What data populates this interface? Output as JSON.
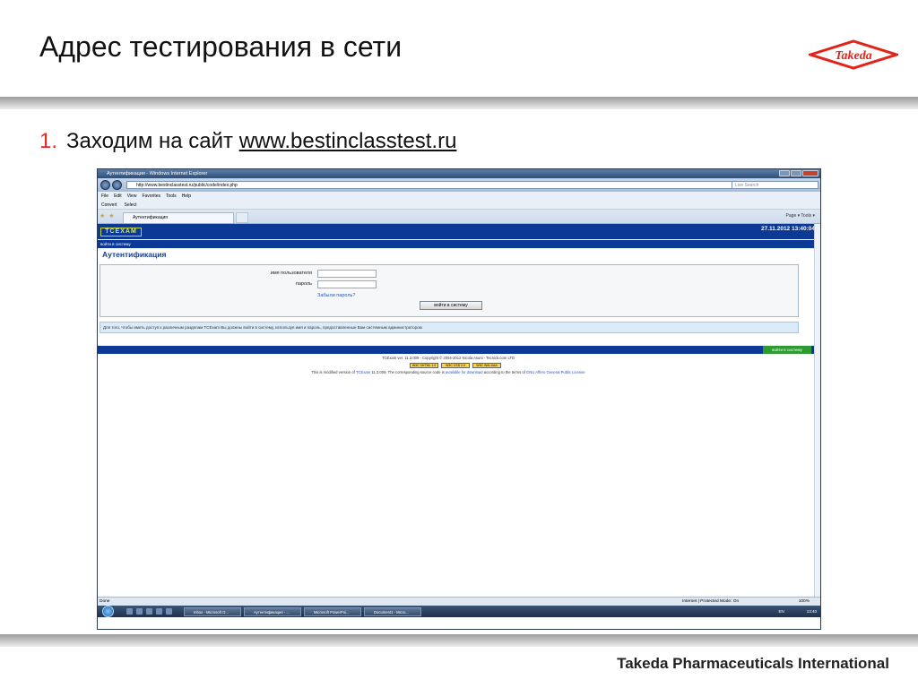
{
  "slide": {
    "title": "Адрес тестирования в сети",
    "logo_text": "Takeda",
    "bullet_number": "1.",
    "bullet_text": "Заходим на сайт",
    "bullet_link": "www.bestinclasstest.ru",
    "footer": "Takeda Pharmaceuticals International"
  },
  "browser": {
    "window_title": "Аутентификация - Windows Internet Explorer",
    "address": "http://www.bestinclasstest.ru/public/code/index.php",
    "search_placeholder": "Live Search",
    "menu": [
      "File",
      "Edit",
      "View",
      "Favorites",
      "Tools",
      "Help"
    ],
    "toolbar": [
      "Convert",
      "Select"
    ],
    "tab_title": "Аутентификация",
    "command_bar": "Page ▾  Tools ▾",
    "status_left": "Done",
    "status_zone": "Internet | Protected Mode: On",
    "zoom": "100%"
  },
  "page": {
    "logo": "TCEXAM",
    "datetime": "27.11.2012 13:40:04",
    "login_bar": "войти в систему",
    "heading": "Аутентификация",
    "username_label": "имя пользователя",
    "password_label": "пароль",
    "forgot": "Забыли пароль?",
    "login_button": "войти в систему",
    "info": "Для того, чтобы иметь доступ к различным разделам TCExam Вы должны войти в систему, используя имя и пароль, предоставленные Вам системным администратором",
    "green_button": "войти в систему",
    "copyright": "TCExam ver. 11.3.009 - Copyright © 2004-2012 Nicola Asuni - Tecnick.com LTD",
    "badges": [
      "W3C XHTML 1.0",
      "W3C CSS 2.0",
      "W3C WAI-AAA"
    ],
    "license_pre": "This is modified version of",
    "license_link1": "TCExam",
    "license_mid": "11.3.009. The corresponding source code is",
    "license_link2": "available for download",
    "license_mid2": "according to the terms of",
    "license_link3": "GNU Affero General Public License"
  },
  "taskbar": {
    "tasks": [
      "Inbox - Microsoft O...",
      "Аутентификация - ...",
      "Microsoft PowerPoi...",
      "Document1 - Micro..."
    ],
    "lang": "EN",
    "time": "13:40"
  }
}
